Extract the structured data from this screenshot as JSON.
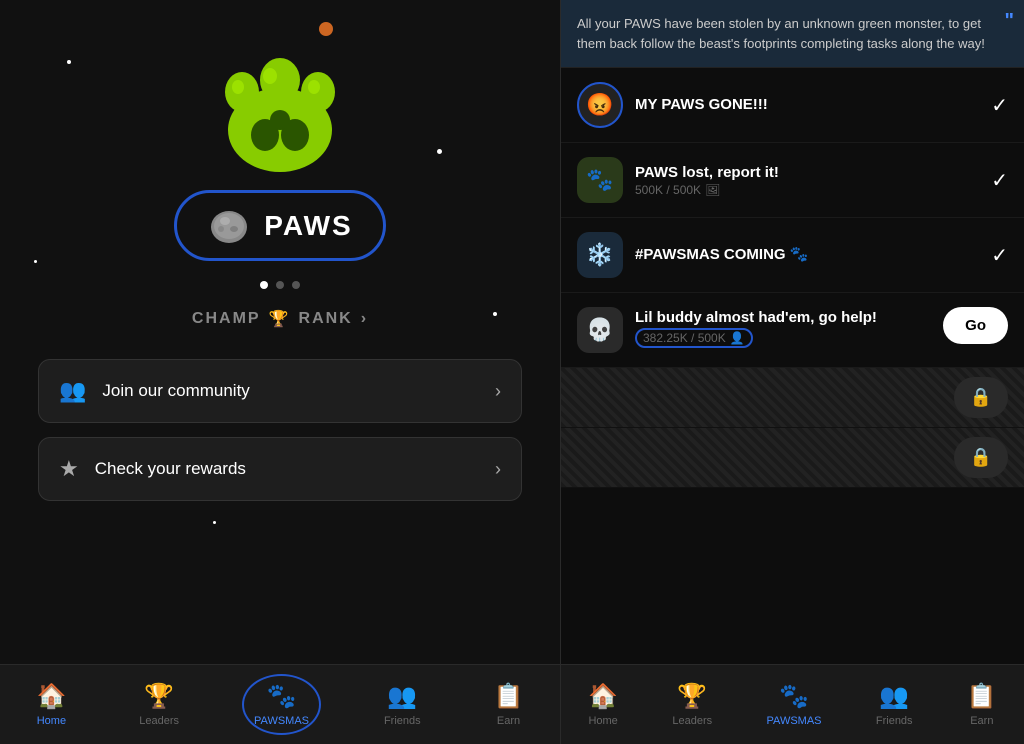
{
  "left": {
    "paws_label": "PAWS",
    "rank_label": "CHAMP",
    "rank_trophy": "🏆",
    "rank_suffix": "RANK",
    "dots": [
      true,
      false,
      false
    ],
    "buttons": [
      {
        "id": "community",
        "icon": "👥",
        "label": "Join our community",
        "chevron": "›"
      },
      {
        "id": "rewards",
        "icon": "★",
        "label": "Check your rewards",
        "chevron": "›"
      }
    ],
    "nav": [
      {
        "id": "home",
        "icon": "⌂",
        "label": "Home",
        "active": true
      },
      {
        "id": "leaders",
        "icon": "🏆",
        "label": "Leaders",
        "active": false
      },
      {
        "id": "pawsmas",
        "icon": "✦",
        "label": "PAWSMAS",
        "active": false,
        "circled": true
      },
      {
        "id": "friends",
        "icon": "👥",
        "label": "Friends",
        "active": false
      },
      {
        "id": "earn",
        "icon": "≡",
        "label": "Earn",
        "active": false
      }
    ]
  },
  "right": {
    "story_text": "All your PAWS have been stolen by an unknown green monster, to get them back follow the beast's footprints completing tasks along the way!",
    "tasks": [
      {
        "id": "task1",
        "icon": "😡",
        "icon_type": "angry",
        "title": "MY PAWS GONE!!!",
        "sub": "",
        "checked": true,
        "has_go": false,
        "locked": false,
        "circled_icon": true
      },
      {
        "id": "task2",
        "icon": "🐾",
        "icon_type": "paws-green",
        "title": "PAWS lost, report it!",
        "sub": "500K / 500K",
        "sub_icon": "🖼",
        "checked": true,
        "has_go": false,
        "locked": false
      },
      {
        "id": "task3",
        "icon": "❄️",
        "icon_type": "snowflake",
        "title": "#PAWSMAS COMING 🐾",
        "sub": "",
        "checked": true,
        "has_go": false,
        "locked": false
      },
      {
        "id": "task4",
        "icon": "💀",
        "icon_type": "skull",
        "title": "Lil buddy almost had'em, go help!",
        "sub": "382.25K / 500K",
        "sub_icon": "👤",
        "checked": false,
        "has_go": true,
        "go_label": "Go",
        "locked": false,
        "circled_progress": true
      }
    ],
    "locked_rows": 2,
    "nav": [
      {
        "id": "home",
        "icon": "⌂",
        "label": "Home",
        "active": false
      },
      {
        "id": "leaders",
        "icon": "🏆",
        "label": "Leaders",
        "active": false
      },
      {
        "id": "pawsmas",
        "icon": "✦",
        "label": "PAWSMAS",
        "active": true
      },
      {
        "id": "friends",
        "icon": "👥",
        "label": "Friends",
        "active": false
      },
      {
        "id": "earn",
        "icon": "≡",
        "label": "Earn",
        "active": false
      }
    ]
  }
}
